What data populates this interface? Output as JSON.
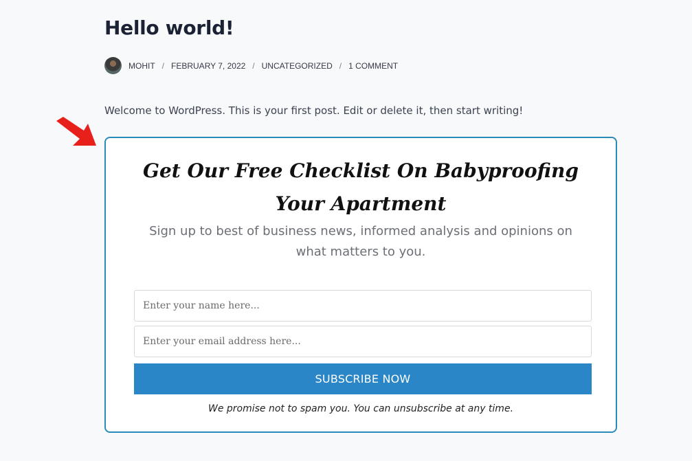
{
  "post": {
    "title": "Hello world!",
    "meta": {
      "author": "MOHIT",
      "date": "FEBRUARY 7, 2022",
      "category": "UNCATEGORIZED",
      "comments": "1 COMMENT",
      "separator": "/"
    },
    "intro": "Welcome to WordPress. This is your first post. Edit or delete it, then start writing!"
  },
  "optin": {
    "heading": "Get Our Free Checklist On Babyproofing Your Apartment",
    "subheading": "Sign up to best of business news, informed analysis and opinions on what matters to you.",
    "name_placeholder": "Enter your name here...",
    "email_placeholder": "Enter your email address here...",
    "button_label": "SUBSCRIBE NOW",
    "disclaimer": "We promise not to spam you. You can unsubscribe at any time."
  },
  "colors": {
    "accent": "#2a86c6",
    "border": "#2a8ab8",
    "arrow": "#e8201c"
  },
  "icons": {
    "arrow": "red-arrow-icon",
    "avatar": "author-avatar"
  }
}
